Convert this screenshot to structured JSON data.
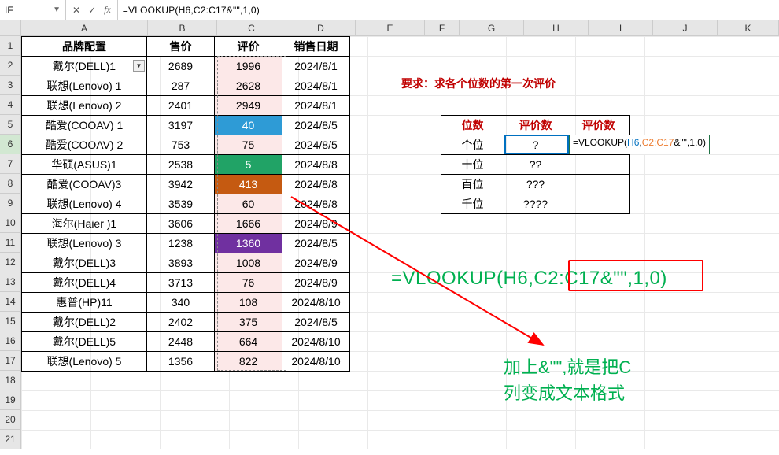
{
  "formula_bar": {
    "name_box": "IF",
    "cancel": "✕",
    "accept": "✓",
    "fx": "fx",
    "formula": "=VLOOKUP(H6,C2:C17&\"\",1,0)"
  },
  "columns": [
    "A",
    "B",
    "C",
    "D",
    "E",
    "F",
    "G",
    "H",
    "I",
    "J",
    "K"
  ],
  "row_count": 21,
  "active_row": 6,
  "main_table": {
    "headers": [
      "品牌配置",
      "售价",
      "评价",
      "销售日期"
    ],
    "rows": [
      {
        "brand": "戴尔(DELL)1",
        "price": "2689",
        "rating": "1996",
        "date": "2024/8/1",
        "ratingClass": "",
        "hasDropdown": true
      },
      {
        "brand": "联想(Lenovo)  1",
        "price": "287",
        "rating": "2628",
        "date": "2024/8/1",
        "ratingClass": ""
      },
      {
        "brand": "联想(Lenovo)  2",
        "price": "2401",
        "rating": "2949",
        "date": "2024/8/1",
        "ratingClass": ""
      },
      {
        "brand": "酷爱(COOAV)  1",
        "price": "3197",
        "rating": "40",
        "date": "2024/8/5",
        "ratingClass": "rating-blue"
      },
      {
        "brand": "酷爱(COOAV)  2",
        "price": "753",
        "rating": "75",
        "date": "2024/8/5",
        "ratingClass": ""
      },
      {
        "brand": "华硕(ASUS)1",
        "price": "2538",
        "rating": "5",
        "date": "2024/8/8",
        "ratingClass": "rating-green"
      },
      {
        "brand": "酷爱(COOAV)3",
        "price": "3942",
        "rating": "413",
        "date": "2024/8/8",
        "ratingClass": "rating-orange"
      },
      {
        "brand": "联想(Lenovo)  4",
        "price": "3539",
        "rating": "60",
        "date": "2024/8/8",
        "ratingClass": ""
      },
      {
        "brand": "海尔(Haier )1",
        "price": "3606",
        "rating": "1666",
        "date": "2024/8/9",
        "ratingClass": ""
      },
      {
        "brand": "联想(Lenovo)  3",
        "price": "1238",
        "rating": "1360",
        "date": "2024/8/5",
        "ratingClass": "rating-purple"
      },
      {
        "brand": "戴尔(DELL)3",
        "price": "3893",
        "rating": "1008",
        "date": "2024/8/9",
        "ratingClass": ""
      },
      {
        "brand": "戴尔(DELL)4",
        "price": "3713",
        "rating": "76",
        "date": "2024/8/9",
        "ratingClass": ""
      },
      {
        "brand": "惠普(HP)11",
        "price": "340",
        "rating": "108",
        "date": "2024/8/10",
        "ratingClass": ""
      },
      {
        "brand": "戴尔(DELL)2",
        "price": "2402",
        "rating": "375",
        "date": "2024/8/5",
        "ratingClass": ""
      },
      {
        "brand": "戴尔(DELL)5",
        "price": "2448",
        "rating": "664",
        "date": "2024/8/10",
        "ratingClass": ""
      },
      {
        "brand": "联想(Lenovo)  5",
        "price": "1356",
        "rating": "822",
        "date": "2024/8/10",
        "ratingClass": ""
      }
    ]
  },
  "requirement": "要求：求各个位数的第一次评价",
  "lookup_table": {
    "headers": [
      "位数",
      "评价数",
      "评价数"
    ],
    "rows": [
      {
        "digit": "个位",
        "mask": "?",
        "result": ""
      },
      {
        "digit": "十位",
        "mask": "??",
        "result": ""
      },
      {
        "digit": "百位",
        "mask": "???",
        "result": ""
      },
      {
        "digit": "千位",
        "mask": "????",
        "result": ""
      }
    ]
  },
  "editing_cell": {
    "prefix": "=VLOOKUP(",
    "arg1": "H6",
    "sep1": ",",
    "arg2": "C2:C17",
    "suffix": "&\"\",1,0)"
  },
  "big_formula": {
    "prefix": "=VLOOKUP(H6,",
    "mid": "C2:C17&\"\"",
    "suffix": ",1,0)"
  },
  "green_note_line1": "加上&\"\",就是把C",
  "green_note_line2": "列变成文本格式"
}
